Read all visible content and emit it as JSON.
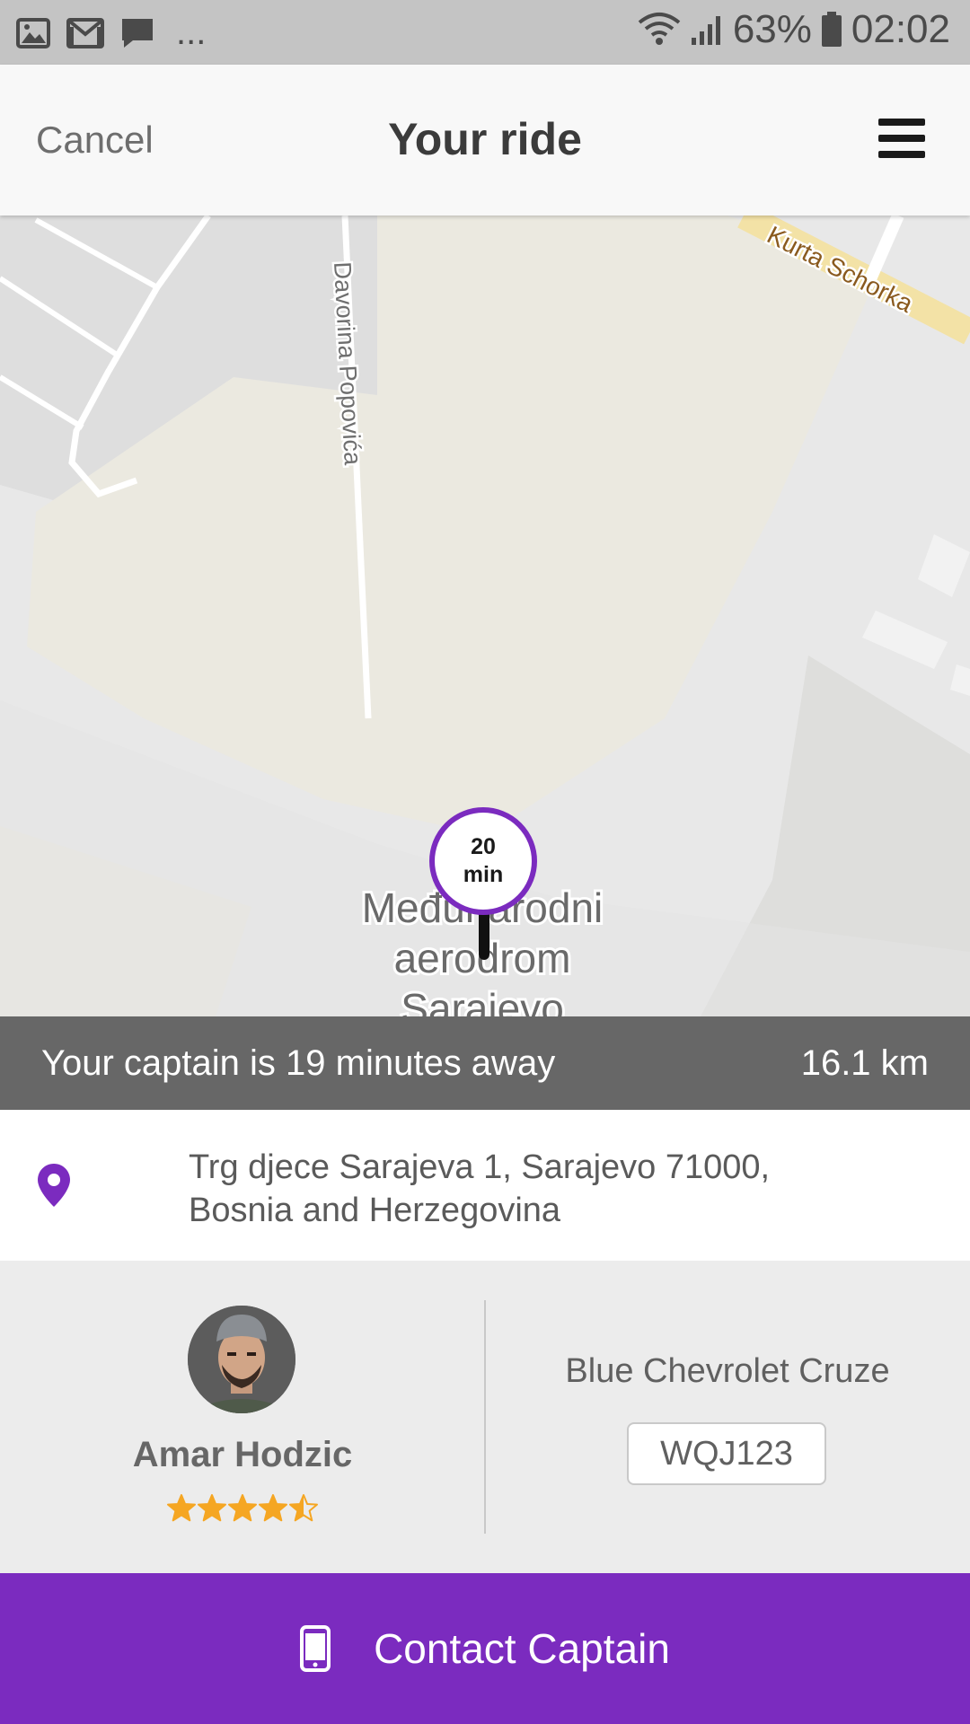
{
  "status_bar": {
    "icons_left": [
      "image-icon",
      "gmail-icon",
      "chat-icon"
    ],
    "more": "...",
    "battery": "63%",
    "time": "02:02"
  },
  "header": {
    "cancel_label": "Cancel",
    "title": "Your ride",
    "menu_icon": "hamburger-menu-icon"
  },
  "map": {
    "streets": [
      "Davorina Popovića",
      "Kurta Schorka"
    ],
    "place_label_line1": "Međunarodni",
    "place_label_line2": "aerodrom",
    "place_label_line3": "Sarajevo",
    "marker_value": "20",
    "marker_unit": "min"
  },
  "eta": {
    "text": "Your captain is 19 minutes away",
    "distance": "16.1 km"
  },
  "pickup": {
    "icon": "location-pin-icon",
    "address_line1": "Trg djece Sarajeva 1, Sarajevo 71000,",
    "address_line2": "Bosnia and Herzegovina"
  },
  "driver": {
    "name": "Amar Hodzic",
    "rating": 4.5,
    "rating_max": 5
  },
  "vehicle": {
    "model": "Blue Chevrolet Cruze",
    "plate": "WQJ123"
  },
  "contact_button": {
    "label": "Contact Captain",
    "icon": "phone-icon"
  },
  "colors": {
    "accent": "#7b2bbf",
    "star": "#f5a623",
    "eta_banner": "#676767"
  }
}
